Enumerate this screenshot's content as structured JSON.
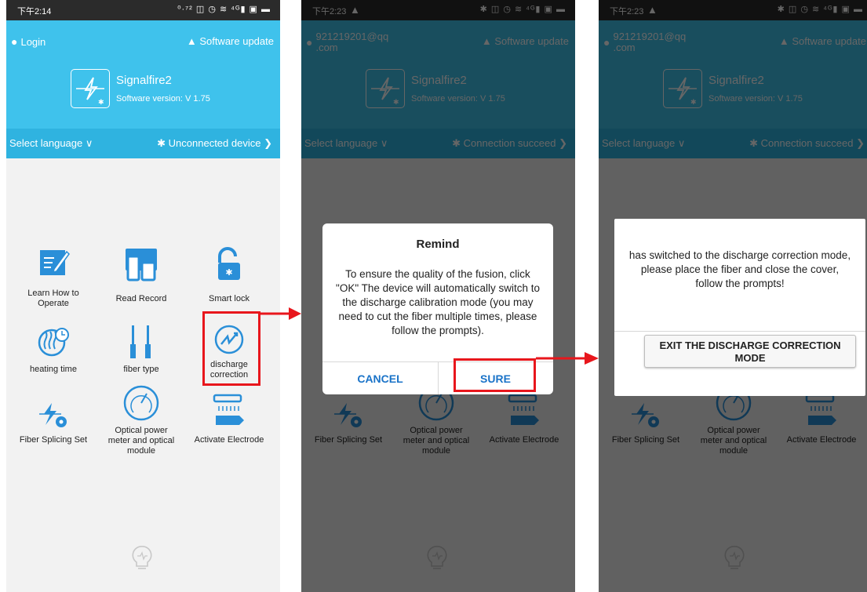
{
  "phones": [
    {
      "status_time": "下午2:14",
      "status_icons": "⁰·⁷² ◫ ◷ ≋ ⁴ᴳ▮ ▣ ▬",
      "login_label": "Login",
      "login_lines": [],
      "software_update": "Software update",
      "app_name": "Signalfire2",
      "app_version": "Software version: V 1.75",
      "select_language": "Select language",
      "connection": "Unconnected device"
    },
    {
      "status_time": "下午2:23",
      "status_icons": "✱ ◫ ◷ ≋ ⁴ᴳ▮ ▣ ▬",
      "login_lines": [
        "921219201@qq",
        ".com"
      ],
      "software_update": "Software update",
      "app_name": "Signalfire2",
      "app_version": "Software version: V 1.75",
      "select_language": "Select language",
      "connection": "Connection succeed"
    },
    {
      "status_time": "下午2:23",
      "status_icons": "✱ ◫ ◷ ≋ ⁴ᴳ▮ ▣ ▬",
      "login_lines": [
        "921219201@qq",
        ".com"
      ],
      "software_update": "Software update",
      "app_name": "Signalfire2",
      "app_version": "Software version: V 1.75",
      "select_language": "Select language",
      "connection": "Connection succeed"
    }
  ],
  "menu": {
    "learn": [
      "Learn How to",
      "Operate"
    ],
    "read_record": "Read Record",
    "smart_lock": "Smart lock",
    "heating_time": "heating time",
    "fiber_type": "fiber type",
    "discharge": [
      "discharge",
      "correction"
    ],
    "fiber_splicing_set": "Fiber Splicing Set",
    "optical": [
      "Optical power",
      "meter and optical",
      "module"
    ],
    "activate_electrode": "Activate Electrode"
  },
  "remind_dialog": {
    "title": "Remind",
    "body": "To ensure the quality of the fusion, click \"OK\" The device will automatically switch to the discharge calibration mode (you may need to cut the fiber multiple times, please follow the prompts).",
    "cancel": "CANCEL",
    "sure": "SURE"
  },
  "discharge_dialog": {
    "message": "has switched to the discharge correction mode, please place the fiber and close the cover, follow the prompts!",
    "exit_button": "EXIT THE DISCHARGE CORRECTION MODE"
  },
  "colors": {
    "header": "#3fc2ec",
    "lang_bar": "#2fb3e0",
    "accent_blue": "#1a73c8",
    "icon_blue": "#2a8fd8",
    "highlight_red": "#e8161c"
  }
}
